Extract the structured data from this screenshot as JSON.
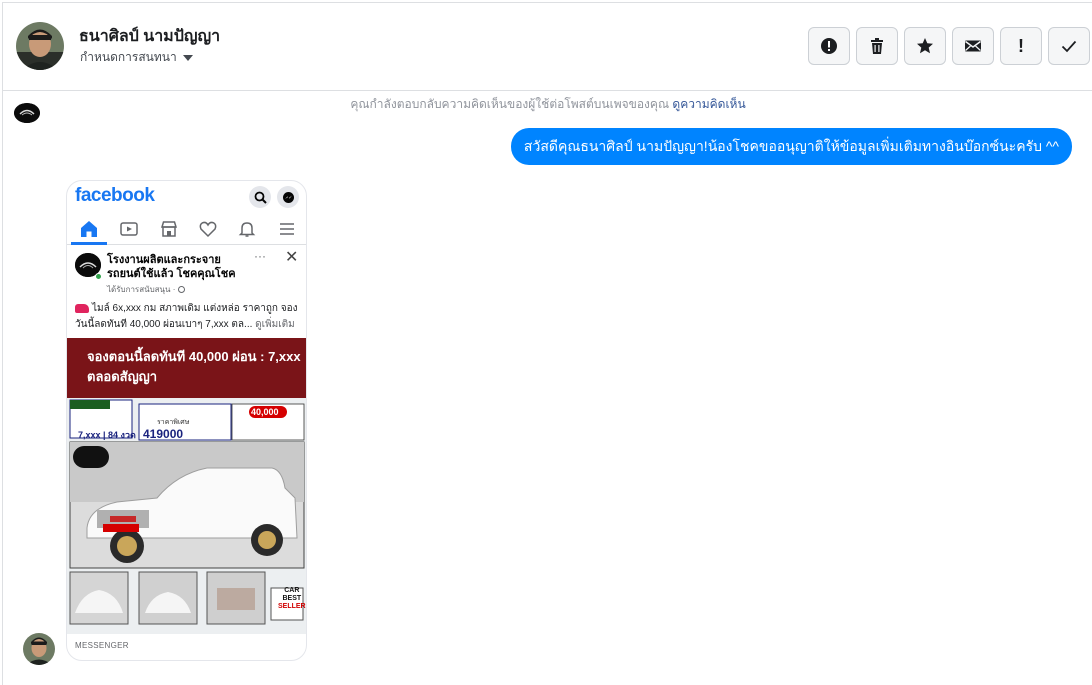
{
  "header": {
    "contact_name": "ธนาศิลป์ นามปัญญา",
    "assign_label": "กำหนดการสนทนา"
  },
  "toolbar": {
    "buttons": [
      {
        "name": "spam-button",
        "icon": "alert-circle-icon"
      },
      {
        "name": "delete-button",
        "icon": "trash-icon"
      },
      {
        "name": "star-button",
        "icon": "star-icon"
      },
      {
        "name": "mark-unread-button",
        "icon": "envelope-icon"
      },
      {
        "name": "follow-up-button",
        "icon": "exclamation-icon",
        "label": "!"
      },
      {
        "name": "mark-done-button",
        "icon": "checkmark-icon"
      }
    ]
  },
  "conversation": {
    "notice_text": "คุณกำลังตอบกลับความคิดเห็นของผู้ใช้ต่อโพสต์บนเพจของคุณ",
    "notice_link": "ดูความคิดเห็น",
    "outgoing_message": "สวัสดีคุณธนาศิลป์ นามปัญญา!น้องโชคขออนุญาติให้ข้อมูลเพิ่มเติมทางอินบ๊อกซ์นะครับ ^^",
    "bubble_color": "#0084ff"
  },
  "shared_screenshot": {
    "app_logo": "facebook",
    "page_name": "โรงงานผลิตและกระจาย รถยนต์ใช้แล้ว โชคคุณโชค",
    "sponsored": "ได้รับการสนับสนุน · ",
    "more_menu": "···",
    "close": "✕",
    "post_text": "ไมล์ 6x,xxx กม สภาพเดิม แต่งหล่อ ราคาถูก จอง วันนี้ลดทันที 40,000 ผ่อนเบาๆ 7,xxx ตล...",
    "see_more": "ดูเพิ่มเติม",
    "banner_text": "จองตอนนี้ลดทันที 40,000 ผ่อน : 7,xxx ตลอดสัญญา",
    "ad_monthly": "7,xxx | 84 งวด",
    "ad_price_label": "ราคาพิเศษ",
    "ad_price": "419000",
    "ad_discount": "40,000",
    "ad_badge_line1": "CAR",
    "ad_badge_line2": "BEST",
    "ad_badge_line3": "SELLER",
    "footer_label": "MESSENGER",
    "banner_color": "#7a1418",
    "facebook_blue": "#1877f2"
  }
}
